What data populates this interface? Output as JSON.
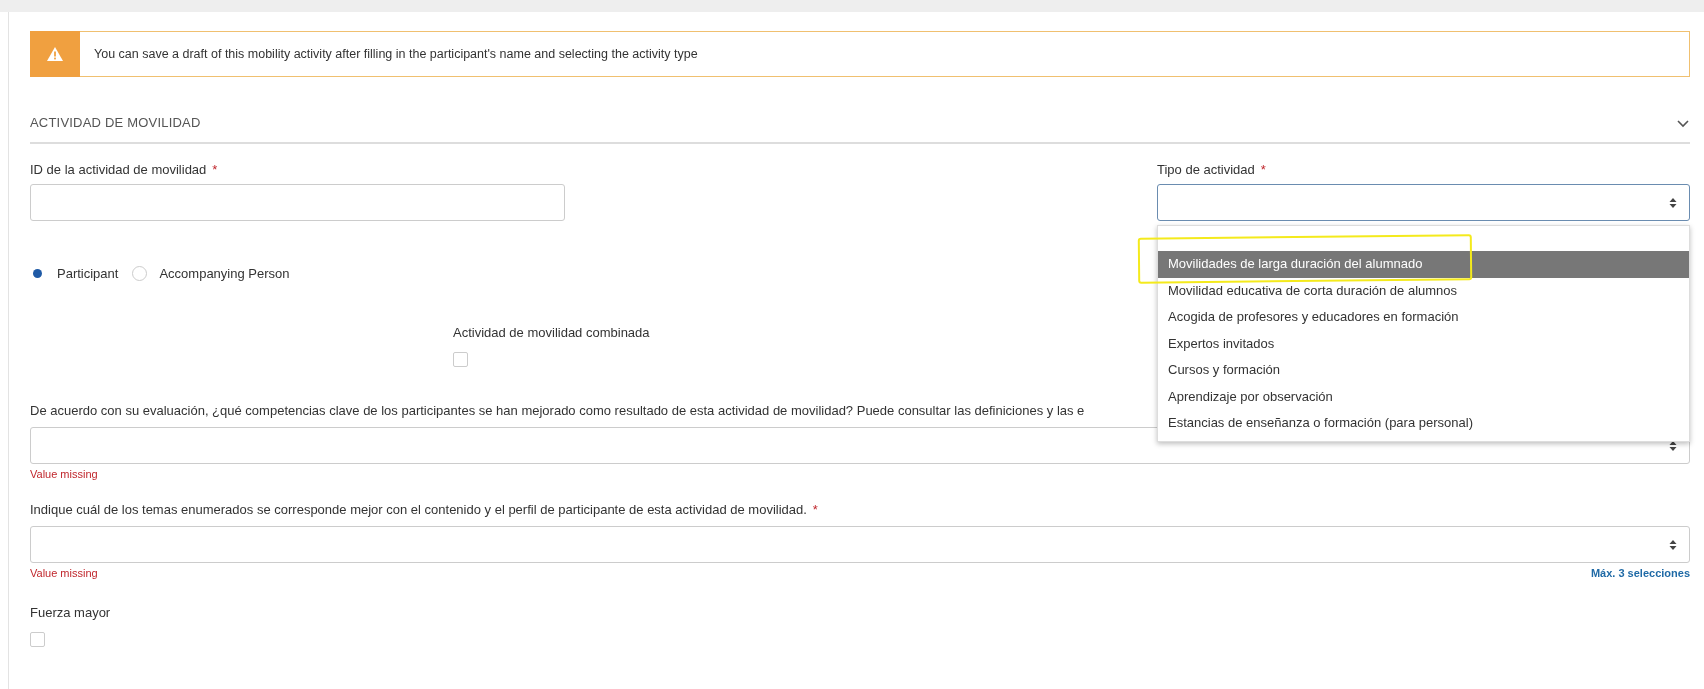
{
  "alert": {
    "text": "You can save a draft of this mobility activity after filling in the participant's name and selecting the activity type"
  },
  "section": {
    "title": "ACTIVIDAD DE MOVILIDAD",
    "expanded": true
  },
  "id_field": {
    "label": "ID de la actividad de movilidad",
    "required_marker": "*"
  },
  "activity_type": {
    "label": "Tipo de actividad",
    "required_marker": "*",
    "open": true,
    "options": [
      {
        "label": "Movilidades de larga duración del alumnado",
        "selected": true,
        "circled": true
      },
      {
        "label": "Movilidad educativa de corta duración de alumnos",
        "selected": false,
        "circled": false
      },
      {
        "label": "Acogida de profesores y educadores en formación",
        "selected": false,
        "circled": false
      },
      {
        "label": "Expertos invitados",
        "selected": false,
        "circled": false
      },
      {
        "label": "Cursos y formación",
        "selected": false,
        "circled": false
      },
      {
        "label": "Aprendizaje por observación",
        "selected": false,
        "circled": false
      },
      {
        "label": "Estancias de enseñanza o formación (para personal)",
        "selected": false,
        "circled": false
      }
    ]
  },
  "role_radios": [
    {
      "label": "Participant",
      "selected": true
    },
    {
      "label": "Accompanying Person",
      "selected": false
    }
  ],
  "combined_checkbox": {
    "label": "Actividad de movilidad combinada",
    "checked": false
  },
  "questions": [
    {
      "label": "De acuerdo con su evaluación, ¿qué competencias clave de los participantes se han mejorado como resultado de esta actividad de movilidad? Puede consultar las definiciones y las e",
      "error": "Value missing"
    },
    {
      "label": "Indique cuál de los temas enumerados se corresponde mejor con el contenido y el perfil de participante de esta actividad de movilidad.",
      "required_marker": "*",
      "error": "Value missing",
      "hint": "Máx. 3 selecciones"
    }
  ],
  "force_majeure": {
    "label": "Fuerza mayor",
    "checked": false
  }
}
